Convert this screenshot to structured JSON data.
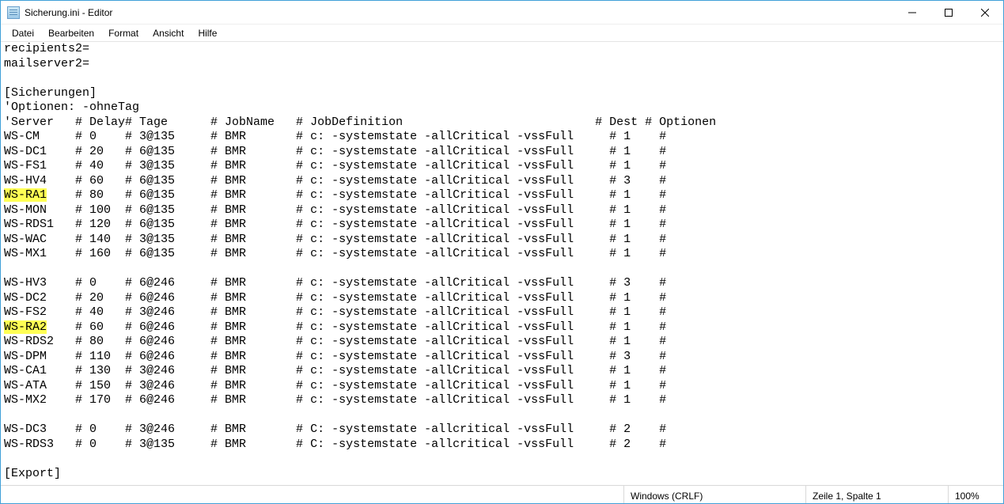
{
  "window": {
    "title": "Sicherung.ini - Editor"
  },
  "menu": {
    "items": [
      {
        "label": "Datei"
      },
      {
        "label": "Bearbeiten"
      },
      {
        "label": "Format"
      },
      {
        "label": "Ansicht"
      },
      {
        "label": "Hilfe"
      }
    ]
  },
  "editor": {
    "preamble": [
      "recipients2=",
      "mailserver2=",
      "",
      "[Sicherungen]",
      "'Optionen: -ohneTag"
    ],
    "header": {
      "server": "'Server",
      "delay": "Delay",
      "tage": "Tage",
      "job": "JobName",
      "def": "JobDefinition",
      "dest": "Dest",
      "opt": "Optionen"
    },
    "highlights": [
      "WS-RA1",
      "WS-RA2"
    ],
    "groups": [
      [
        {
          "server": "WS-CM",
          "delay": "0",
          "tage": "3@135",
          "job": "BMR",
          "def": "c: -systemstate -allCritical -vssFull",
          "dest": "1",
          "opt": ""
        },
        {
          "server": "WS-DC1",
          "delay": "20",
          "tage": "6@135",
          "job": "BMR",
          "def": "c: -systemstate -allCritical -vssFull",
          "dest": "1",
          "opt": ""
        },
        {
          "server": "WS-FS1",
          "delay": "40",
          "tage": "3@135",
          "job": "BMR",
          "def": "c: -systemstate -allCritical -vssFull",
          "dest": "1",
          "opt": ""
        },
        {
          "server": "WS-HV4",
          "delay": "60",
          "tage": "6@135",
          "job": "BMR",
          "def": "c: -systemstate -allCritical -vssFull",
          "dest": "3",
          "opt": ""
        },
        {
          "server": "WS-RA1",
          "delay": "80",
          "tage": "6@135",
          "job": "BMR",
          "def": "c: -systemstate -allCritical -vssFull",
          "dest": "1",
          "opt": ""
        },
        {
          "server": "WS-MON",
          "delay": "100",
          "tage": "6@135",
          "job": "BMR",
          "def": "c: -systemstate -allCritical -vssFull",
          "dest": "1",
          "opt": ""
        },
        {
          "server": "WS-RDS1",
          "delay": "120",
          "tage": "6@135",
          "job": "BMR",
          "def": "c: -systemstate -allCritical -vssFull",
          "dest": "1",
          "opt": ""
        },
        {
          "server": "WS-WAC",
          "delay": "140",
          "tage": "3@135",
          "job": "BMR",
          "def": "c: -systemstate -allCritical -vssFull",
          "dest": "1",
          "opt": ""
        },
        {
          "server": "WS-MX1",
          "delay": "160",
          "tage": "6@135",
          "job": "BMR",
          "def": "c: -systemstate -allCritical -vssFull",
          "dest": "1",
          "opt": ""
        }
      ],
      [
        {
          "server": "WS-HV3",
          "delay": "0",
          "tage": "6@246",
          "job": "BMR",
          "def": "c: -systemstate -allCritical -vssFull",
          "dest": "3",
          "opt": ""
        },
        {
          "server": "WS-DC2",
          "delay": "20",
          "tage": "6@246",
          "job": "BMR",
          "def": "c: -systemstate -allCritical -vssFull",
          "dest": "1",
          "opt": ""
        },
        {
          "server": "WS-FS2",
          "delay": "40",
          "tage": "3@246",
          "job": "BMR",
          "def": "c: -systemstate -allCritical -vssFull",
          "dest": "1",
          "opt": ""
        },
        {
          "server": "WS-RA2",
          "delay": "60",
          "tage": "6@246",
          "job": "BMR",
          "def": "c: -systemstate -allCritical -vssFull",
          "dest": "1",
          "opt": ""
        },
        {
          "server": "WS-RDS2",
          "delay": "80",
          "tage": "6@246",
          "job": "BMR",
          "def": "c: -systemstate -allCritical -vssFull",
          "dest": "1",
          "opt": ""
        },
        {
          "server": "WS-DPM",
          "delay": "110",
          "tage": "6@246",
          "job": "BMR",
          "def": "c: -systemstate -allCritical -vssFull",
          "dest": "3",
          "opt": ""
        },
        {
          "server": "WS-CA1",
          "delay": "130",
          "tage": "3@246",
          "job": "BMR",
          "def": "c: -systemstate -allCritical -vssFull",
          "dest": "1",
          "opt": ""
        },
        {
          "server": "WS-ATA",
          "delay": "150",
          "tage": "3@246",
          "job": "BMR",
          "def": "c: -systemstate -allCritical -vssFull",
          "dest": "1",
          "opt": ""
        },
        {
          "server": "WS-MX2",
          "delay": "170",
          "tage": "6@246",
          "job": "BMR",
          "def": "c: -systemstate -allCritical -vssFull",
          "dest": "1",
          "opt": ""
        }
      ],
      [
        {
          "server": "WS-DC3",
          "delay": "0",
          "tage": "3@246",
          "job": "BMR",
          "def": "C: -systemstate -allcritical -vssFull",
          "dest": "2",
          "opt": ""
        },
        {
          "server": "WS-RDS3",
          "delay": "0",
          "tage": "3@135",
          "job": "BMR",
          "def": "C: -systemstate -allcritical -vssFull",
          "dest": "2",
          "opt": ""
        }
      ]
    ],
    "postamble": [
      "",
      "[Export]"
    ]
  },
  "status": {
    "encoding": "Windows (CRLF)",
    "position": "Zeile 1, Spalte 1",
    "zoom": "100%"
  }
}
